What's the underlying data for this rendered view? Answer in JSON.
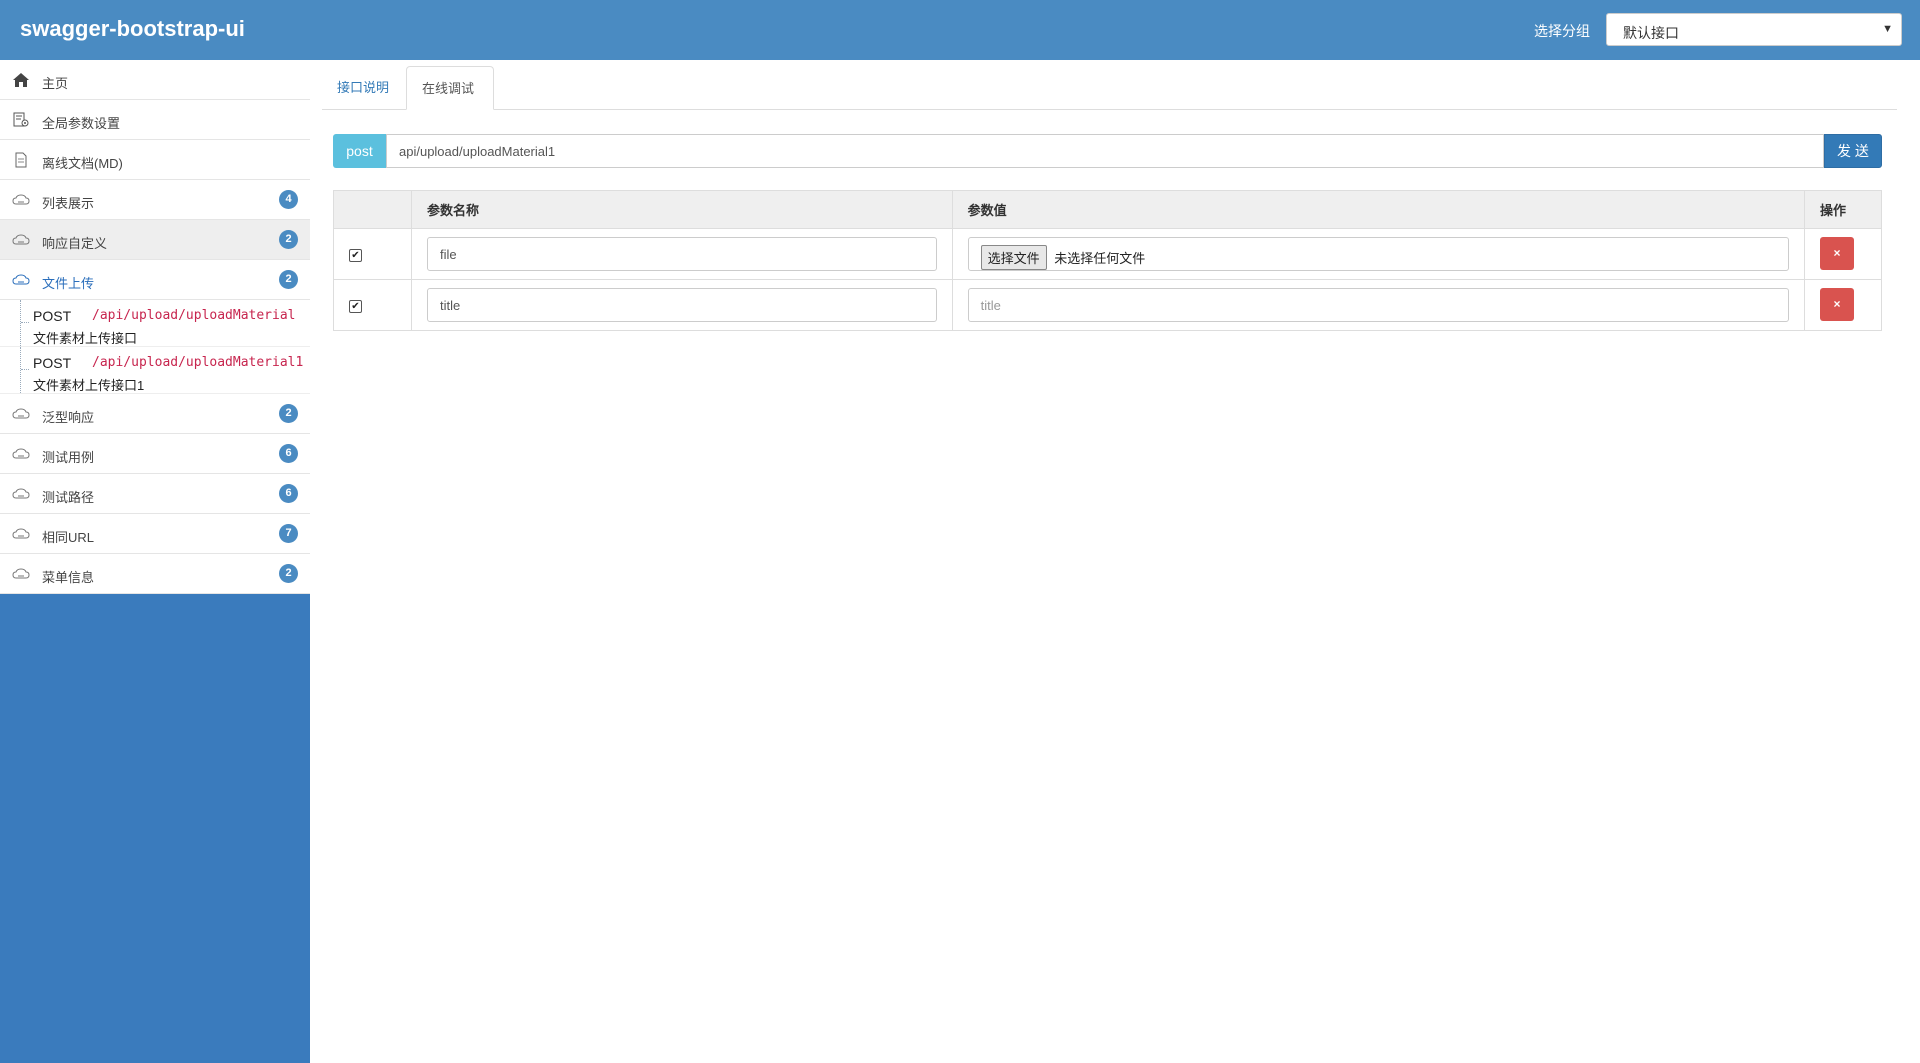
{
  "header": {
    "brand": "swagger-bootstrap-ui",
    "group_label": "选择分组",
    "group_selected": "默认接口"
  },
  "sidebar": {
    "items": [
      {
        "label": "主页",
        "icon": "home-icon"
      },
      {
        "label": "全局参数设置",
        "icon": "settings-doc-icon"
      },
      {
        "label": "离线文档(MD)",
        "icon": "document-icon"
      },
      {
        "label": "列表展示",
        "icon": "cloud-icon",
        "badge": "4"
      },
      {
        "label": "响应自定义",
        "icon": "cloud-icon",
        "badge": "2"
      },
      {
        "label": "文件上传",
        "icon": "cloud-icon",
        "badge": "2"
      },
      {
        "label": "泛型响应",
        "icon": "cloud-icon",
        "badge": "2"
      },
      {
        "label": "测试用例",
        "icon": "cloud-icon",
        "badge": "6"
      },
      {
        "label": "测试路径",
        "icon": "cloud-icon",
        "badge": "6"
      },
      {
        "label": "相同URL",
        "icon": "cloud-icon",
        "badge": "7"
      },
      {
        "label": "菜单信息",
        "icon": "cloud-icon",
        "badge": "2"
      }
    ],
    "sub_items": [
      {
        "method": "POST",
        "path": "/api/upload/uploadMaterial",
        "desc": "文件素材上传接口"
      },
      {
        "method": "POST",
        "path": "/api/upload/uploadMaterial1",
        "desc": "文件素材上传接口1"
      }
    ]
  },
  "tabs": [
    {
      "label": "接口说明"
    },
    {
      "label": "在线调试"
    }
  ],
  "request": {
    "method": "post",
    "url": "api/upload/uploadMaterial1",
    "send_label": "发 送"
  },
  "params_table": {
    "headers": [
      "",
      "参数名称",
      "参数值",
      "操作"
    ],
    "rows": [
      {
        "checked": true,
        "name": "file",
        "value_button": "选择文件",
        "value_text": "未选择任何文件",
        "delete": "×"
      },
      {
        "checked": true,
        "name": "title",
        "value_placeholder": "title",
        "delete": "×"
      }
    ]
  },
  "colors": {
    "header_bg": "#4a8bc2",
    "sidebar_bg": "#3a7bbd",
    "method_bg": "#5bc0de",
    "send_bg": "#337ab7",
    "delete_bg": "#d9534f",
    "path_color": "#c7254e"
  }
}
